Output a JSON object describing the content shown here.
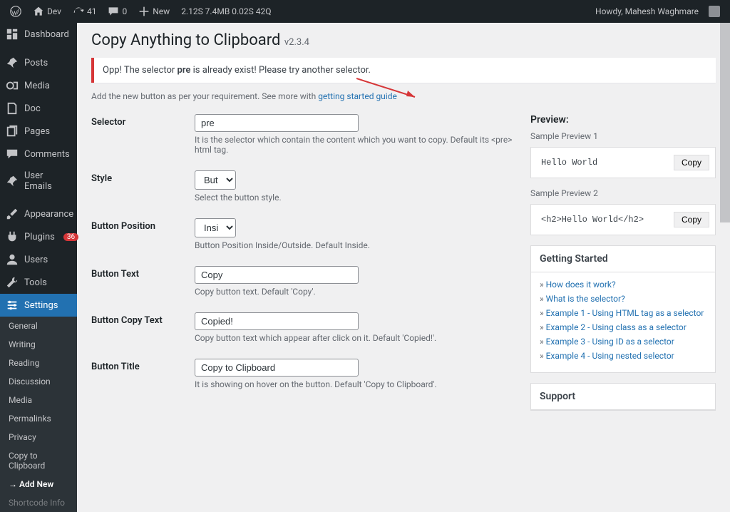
{
  "topbar": {
    "site": "Dev",
    "updates": "41",
    "comments": "0",
    "new": "New",
    "perf": "2.12S  7.4MB  0.02S  42Q",
    "howdy": "Howdy, Mahesh Waghmare"
  },
  "sidebar": {
    "items": [
      {
        "label": "Dashboard"
      },
      {
        "label": "Posts"
      },
      {
        "label": "Media"
      },
      {
        "label": "Doc"
      },
      {
        "label": "Pages"
      },
      {
        "label": "Comments"
      },
      {
        "label": "User Emails"
      },
      {
        "label": "Appearance"
      },
      {
        "label": "Plugins",
        "badge": "36"
      },
      {
        "label": "Users"
      },
      {
        "label": "Tools"
      },
      {
        "label": "Settings"
      }
    ],
    "submenu": [
      "General",
      "Writing",
      "Reading",
      "Discussion",
      "Media",
      "Permalinks",
      "Privacy",
      "Copy to Clipboard",
      "Add New",
      "Shortcode Info"
    ]
  },
  "page": {
    "title": "Copy Anything to Clipboard",
    "version": "v2.3.4",
    "notice_pre": "Opp! The selector ",
    "notice_bold": "pre",
    "notice_post": " is already exist! Please try another selector.",
    "helper_pre": "Add the new button as per your requirement. See more with ",
    "helper_link": "getting started guide"
  },
  "form": {
    "selector": {
      "label": "Selector",
      "value": "pre",
      "desc": "It is the selector which contain the content which you want to copy. Default its <pre> html tag."
    },
    "style": {
      "label": "Style",
      "value": "Button",
      "desc": "Select the button style."
    },
    "position": {
      "label": "Button Position",
      "value": "Inside",
      "desc": "Button Position Inside/Outside. Default Inside."
    },
    "text": {
      "label": "Button Text",
      "value": "Copy",
      "desc": "Copy button text. Default 'Copy'."
    },
    "copytext": {
      "label": "Button Copy Text",
      "value": "Copied!",
      "desc": "Copy button text which appear after click on it. Default 'Copied!'."
    },
    "title": {
      "label": "Button Title",
      "value": "Copy to Clipboard",
      "desc": "It is showing on hover on the button. Default 'Copy to Clipboard'."
    }
  },
  "preview": {
    "head": "Preview:",
    "s1_label": "Sample Preview 1",
    "s1_content": "Hello World",
    "s2_label": "Sample Preview 2",
    "s2_content": "<h2>Hello World</h2>",
    "copy": "Copy"
  },
  "gs": {
    "head": "Getting Started",
    "links": [
      "How does it work?",
      "What is the selector?",
      "Example 1 - Using HTML tag as a selector",
      "Example 2 - Using class as a selector",
      "Example 3 - Using ID as a selector",
      "Example 4 - Using nested selector"
    ]
  },
  "support": {
    "head": "Support"
  }
}
